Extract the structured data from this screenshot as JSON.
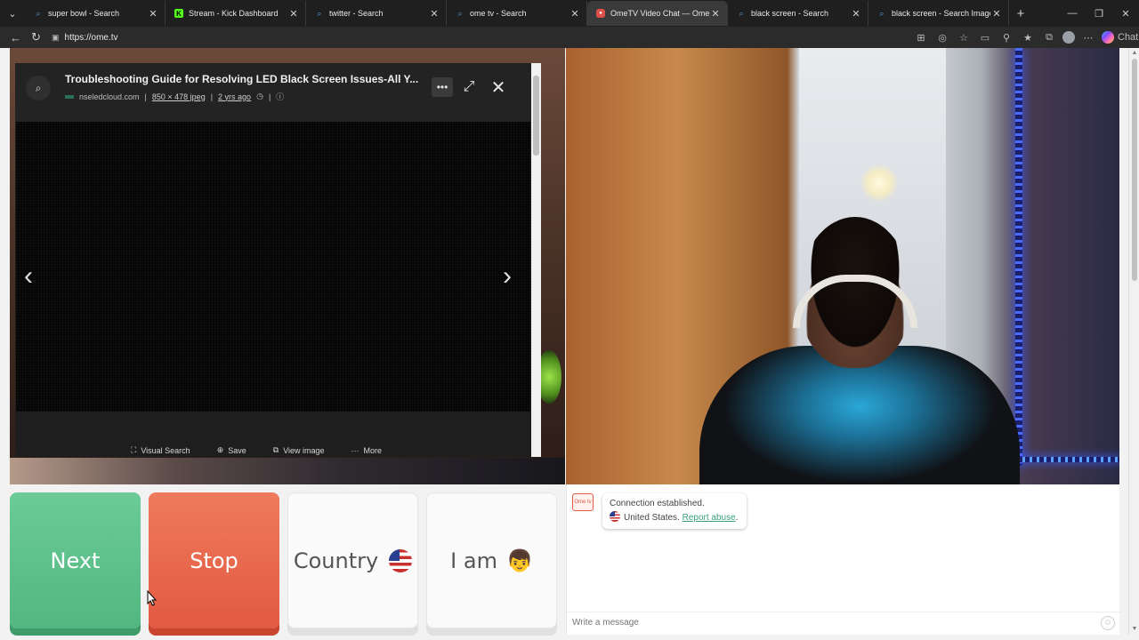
{
  "tabs": [
    {
      "title": "super bowl - Search",
      "icon": "search-icon",
      "active": false
    },
    {
      "title": "Stream - Kick Dashboard",
      "icon": "kick-icon",
      "active": false
    },
    {
      "title": "twitter - Search",
      "icon": "search-icon",
      "active": false
    },
    {
      "title": "ome tv - Search",
      "icon": "search-icon",
      "active": false
    },
    {
      "title": "OmeTV Video Chat — Omegl",
      "icon": "ometv-icon",
      "active": true
    },
    {
      "title": "black screen - Search",
      "icon": "search-icon",
      "active": false
    },
    {
      "title": "black screen - Search Images",
      "icon": "search-icon",
      "active": false
    }
  ],
  "address": {
    "url": "https://ome.tv"
  },
  "toolbar": {
    "copilot_label": "Chat"
  },
  "viewer": {
    "title": "Troubleshooting Guide for Resolving LED Black Screen Issues-All Y...",
    "source": "nseledcloud.com",
    "dimensions": "850 × 478 jpeg",
    "age": "2 yrs ago",
    "actions": {
      "visual_search": "Visual Search",
      "save": "Save",
      "view_image": "View image",
      "more": "More"
    }
  },
  "buttons": {
    "next": "Next",
    "stop": "Stop",
    "country": "Country",
    "iam": "I am"
  },
  "chat": {
    "logo_text": "Ome tv",
    "status": "Connection established.",
    "country": "United States.",
    "report_link": "Report abuse",
    "report_suffix": ".",
    "placeholder": "Write a message"
  },
  "colors": {
    "next": "#52b780",
    "stop": "#e25a41",
    "link": "#3aa077"
  }
}
